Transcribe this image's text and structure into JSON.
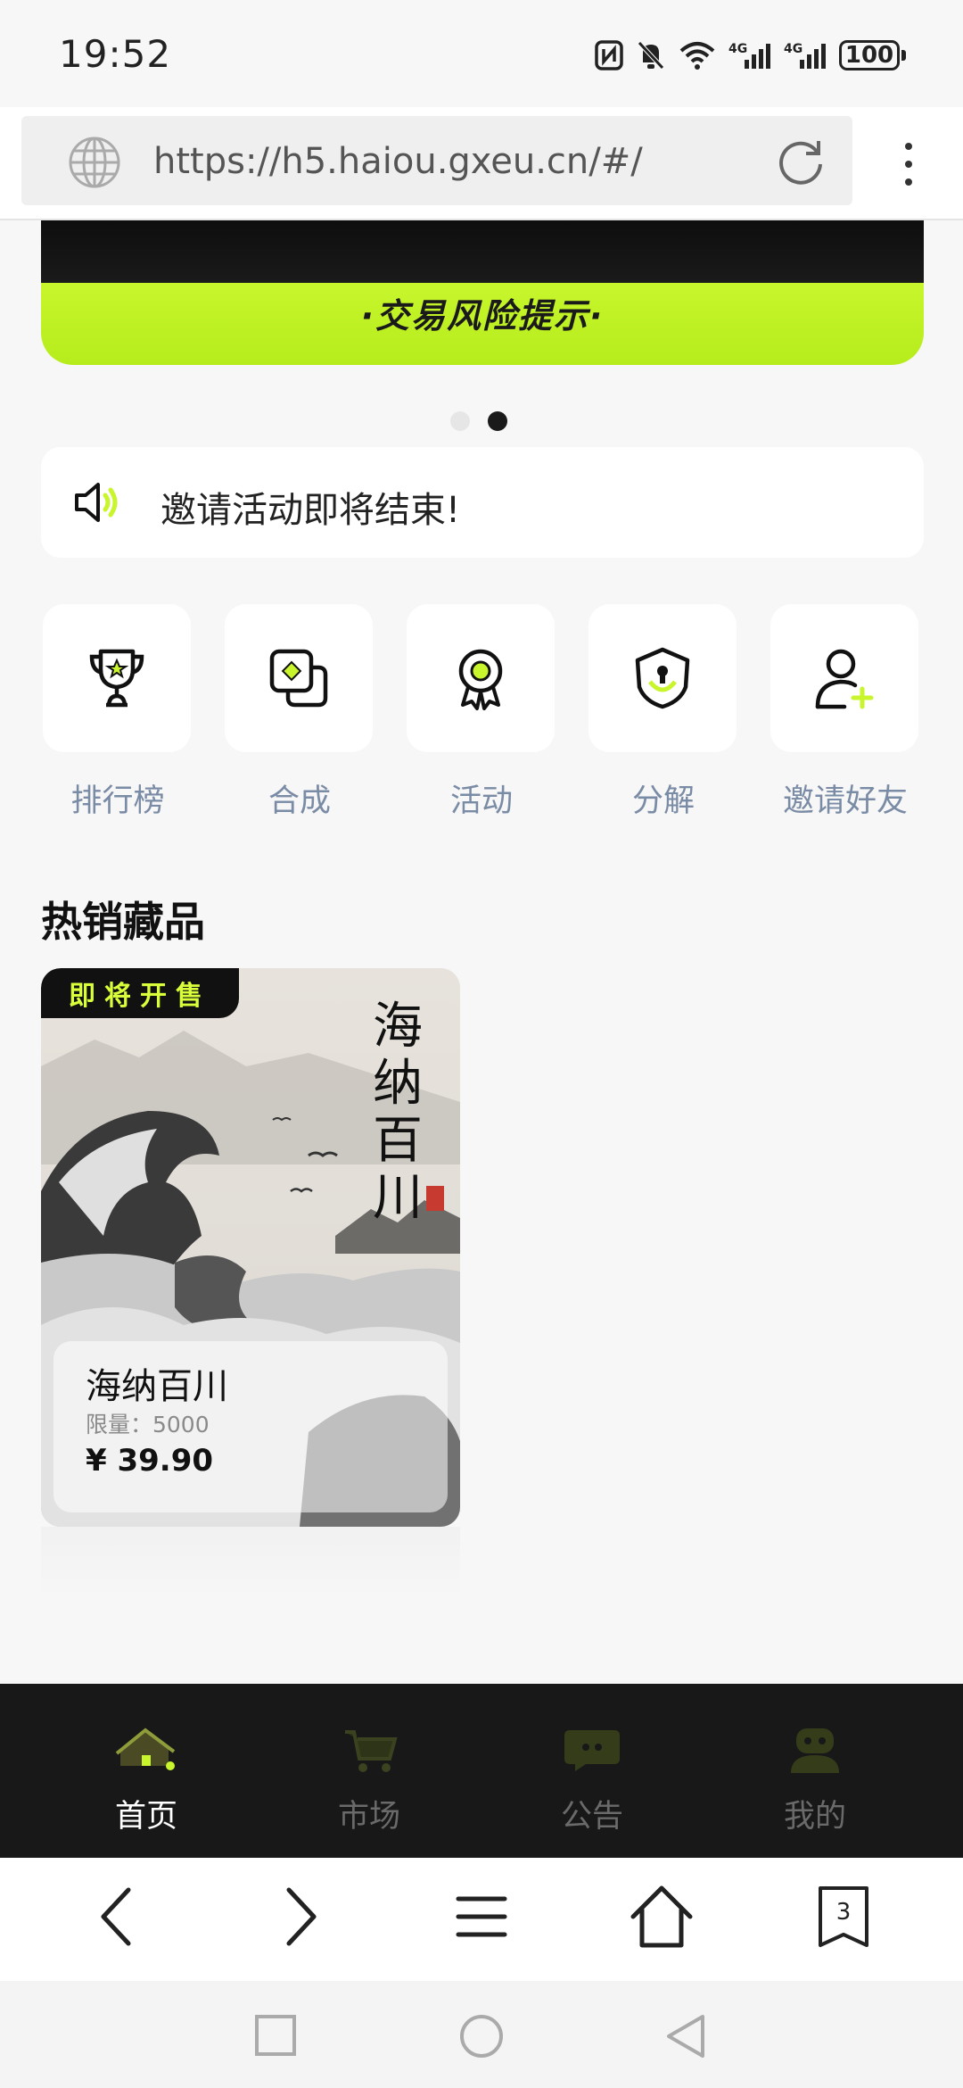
{
  "status_bar": {
    "time": "19:52",
    "battery": "100",
    "network": "4G"
  },
  "browser": {
    "url": "https://h5.haiou.gxeu.cn/#/",
    "tab_count": "3"
  },
  "banner": {
    "text": "·交易风险提示·",
    "accent_color": "#c8f52c"
  },
  "carousel": {
    "count": 2,
    "active_index": 1
  },
  "notice": {
    "text": "邀请活动即将结束!"
  },
  "quick_actions": [
    {
      "label": "排行榜",
      "icon": "trophy-icon"
    },
    {
      "label": "合成",
      "icon": "merge-icon"
    },
    {
      "label": "活动",
      "icon": "medal-icon"
    },
    {
      "label": "分解",
      "icon": "shield-icon"
    },
    {
      "label": "邀请好友",
      "icon": "add-user-icon"
    }
  ],
  "hot_section": {
    "title": "热销藏品",
    "items": [
      {
        "badge": "即将开售",
        "art_title": "海纳百川",
        "name": "海纳百川",
        "limit": "限量：5000",
        "price": "¥ 39.90"
      }
    ]
  },
  "tabbar": {
    "items": [
      {
        "label": "首页",
        "icon": "home-icon",
        "active": true
      },
      {
        "label": "市场",
        "icon": "cart-icon",
        "active": false
      },
      {
        "label": "公告",
        "icon": "chat-icon",
        "active": false
      },
      {
        "label": "我的",
        "icon": "user-icon",
        "active": false
      }
    ]
  }
}
